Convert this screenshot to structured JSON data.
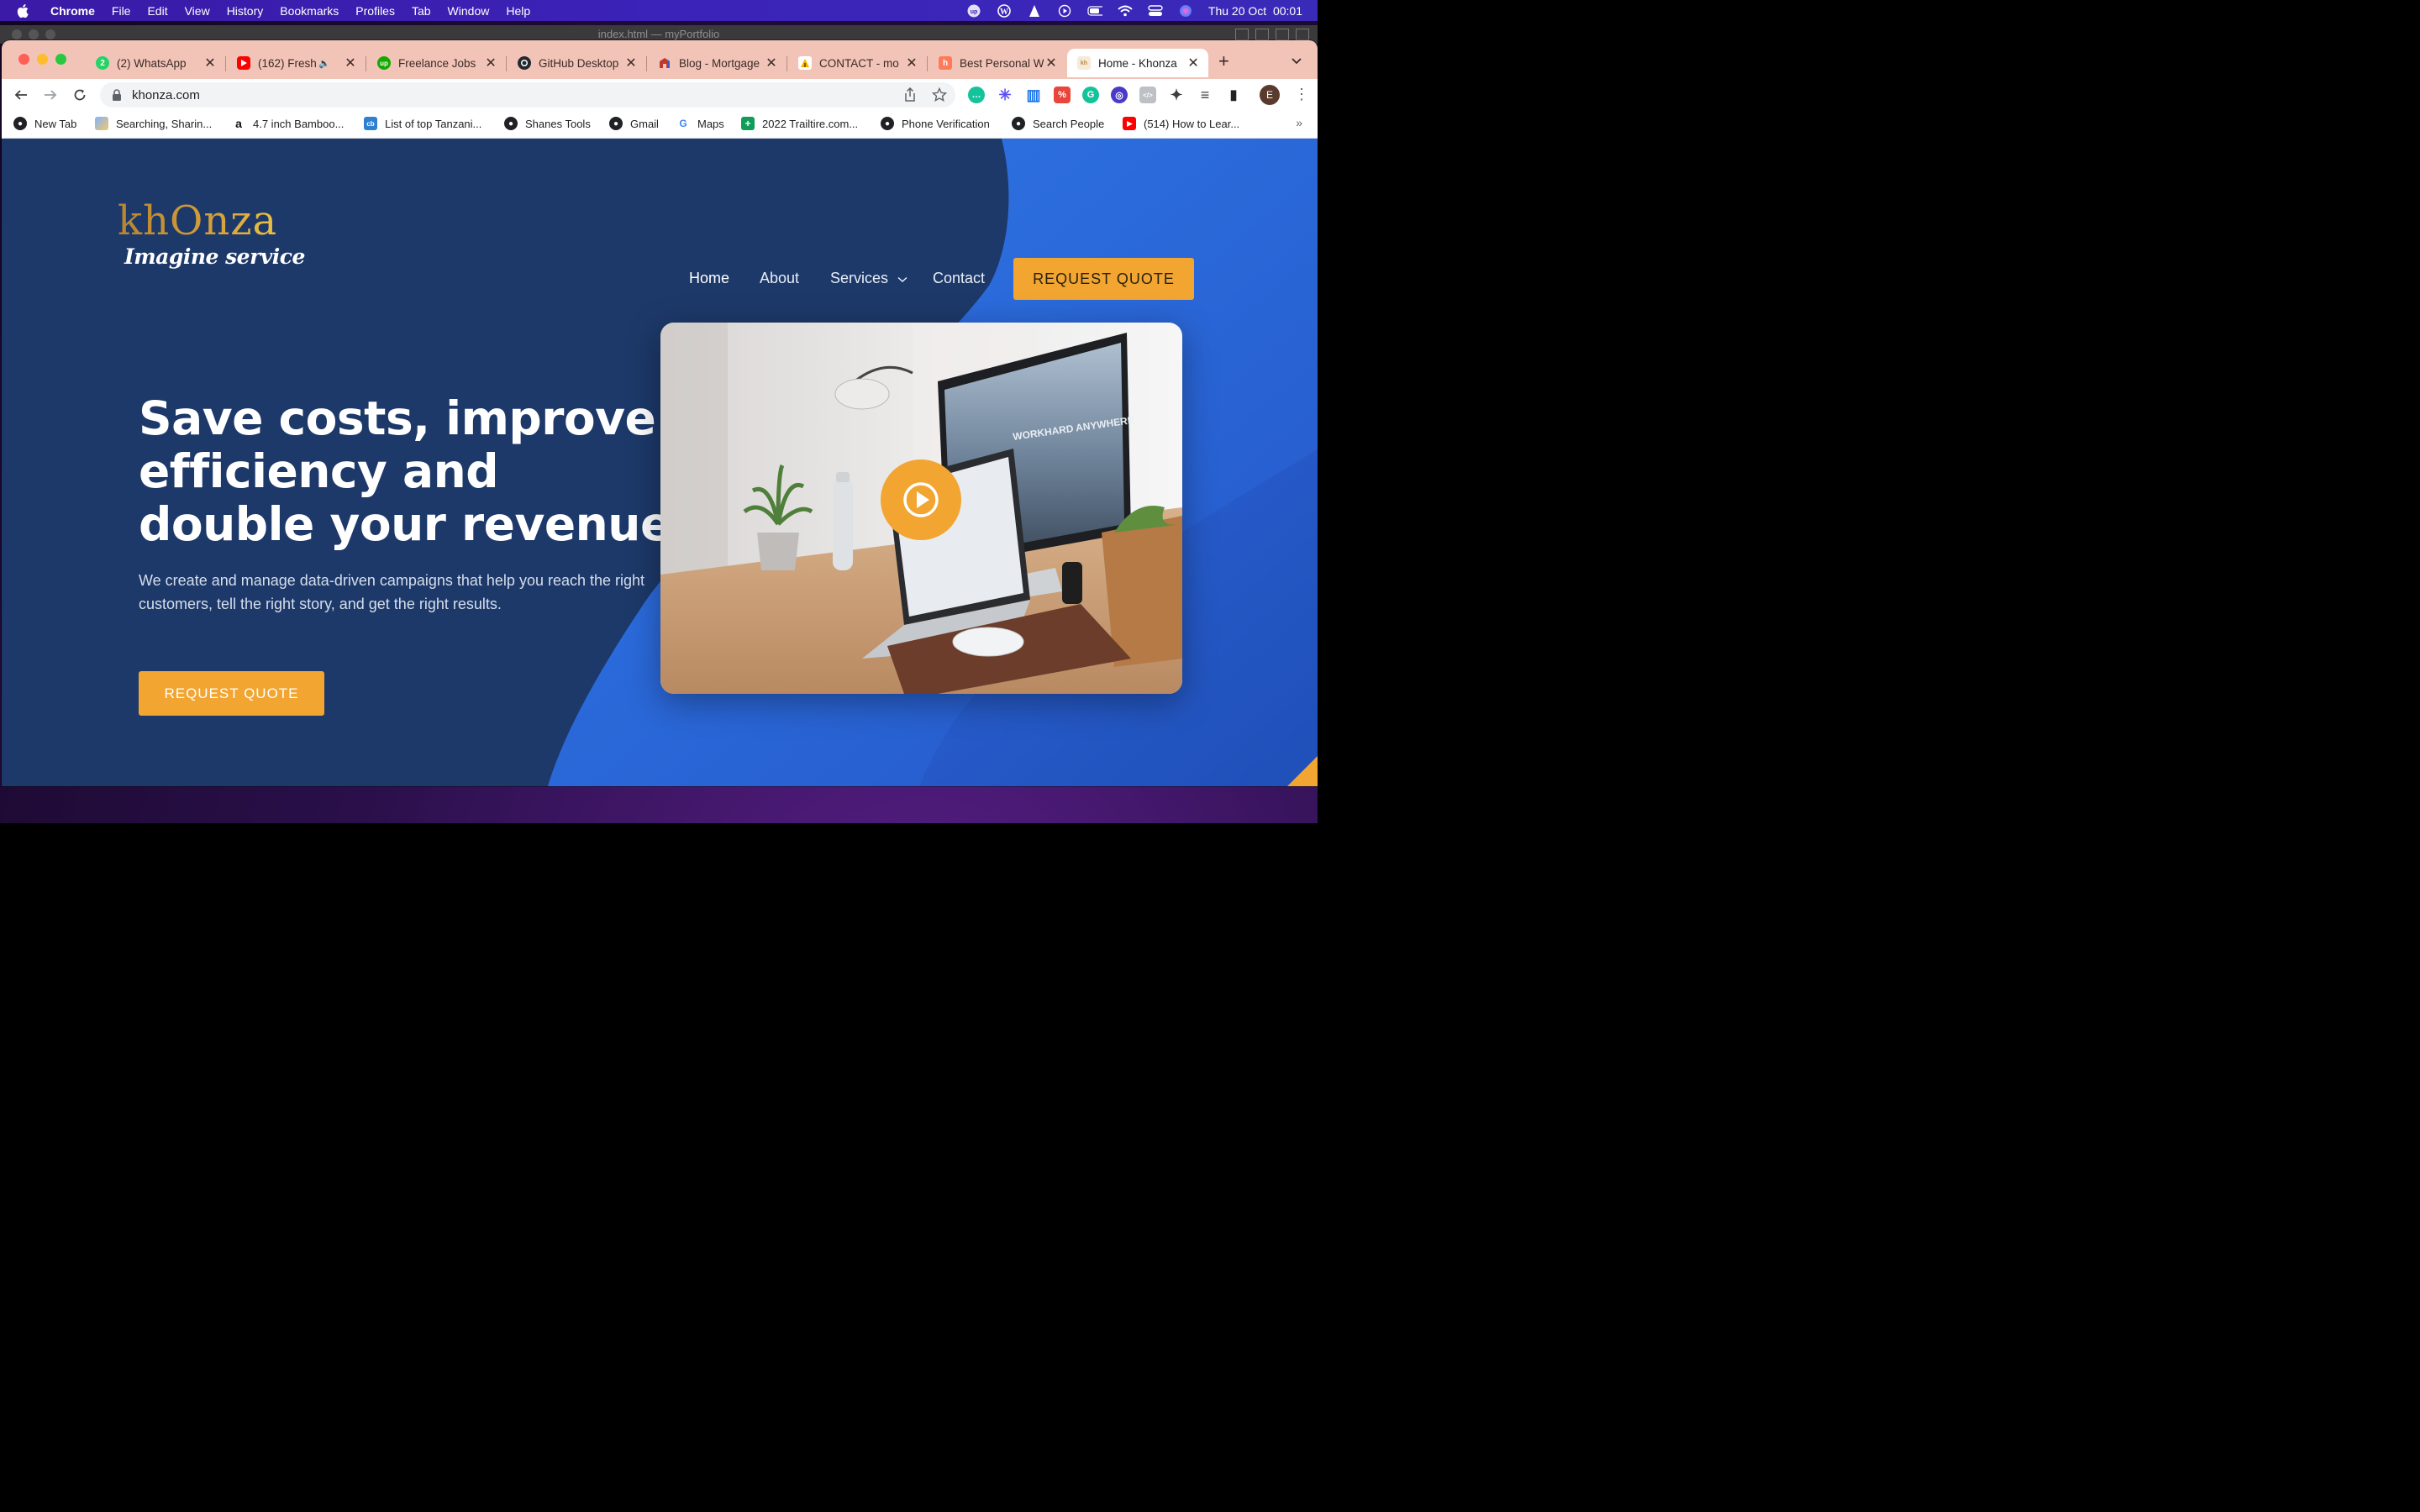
{
  "menubar": {
    "app": "Chrome",
    "items": [
      "File",
      "Edit",
      "View",
      "History",
      "Bookmarks",
      "Profiles",
      "Tab",
      "Window",
      "Help"
    ],
    "datetime": "Thu 20 Oct  00:01",
    "status_icons": [
      "upwork-icon",
      "wordpress-icon",
      "vlc-icon",
      "play-icon",
      "battery-icon",
      "wifi-icon",
      "control-center-icon",
      "siri-icon"
    ]
  },
  "background_window": {
    "title": "index.html — myPortfolio"
  },
  "tabs": [
    {
      "title": "(2) WhatsApp",
      "icon": "whatsapp-icon",
      "color": "#25d366",
      "badge": "2"
    },
    {
      "title": "(162) Fresh",
      "icon": "youtube-icon",
      "color": "#ff0000",
      "muted_indicator": "🔈"
    },
    {
      "title": "Freelance Jobs",
      "icon": "upwork-icon",
      "color": "#14a800",
      "badge": "up"
    },
    {
      "title": "GitHub Desktop",
      "icon": "github-icon",
      "color": "#24292f"
    },
    {
      "title": "Blog - Mortgage",
      "icon": "mortgage-icon",
      "color": "#c0392b"
    },
    {
      "title": "CONTACT - mo",
      "icon": "contact-icon",
      "color": "#f4b400"
    },
    {
      "title": "Best Personal W",
      "icon": "hubspot-icon",
      "color": "#ff7a59"
    },
    {
      "title": "Home - Khonza",
      "icon": "khonza-icon",
      "color": "#e0c8a0",
      "active": true
    }
  ],
  "toolbar": {
    "url": "khonza.com",
    "extensions": [
      {
        "icon": "grammarly-chat-icon",
        "color": "#15c39a",
        "glyph": "…"
      },
      {
        "icon": "snowflake-icon",
        "color": "#5b4ff5",
        "glyph": "✳"
      },
      {
        "icon": "bar-chart-icon",
        "color": "#1a73e8",
        "glyph": "▥"
      },
      {
        "icon": "lastpass-icon",
        "color": "#e8453c",
        "glyph": "%"
      },
      {
        "icon": "grammarly-icon",
        "color": "#15c39a",
        "glyph": "G"
      },
      {
        "icon": "loom-icon",
        "color": "#4b39c9",
        "glyph": "◎"
      },
      {
        "icon": "code-icon",
        "color": "#9aa0a6",
        "glyph": "</>"
      },
      {
        "icon": "puzzle-icon",
        "color": "#5f6368",
        "glyph": "✦"
      },
      {
        "icon": "media-icon",
        "color": "#5f6368",
        "glyph": "≡"
      },
      {
        "icon": "side-panel-icon",
        "color": "#202124",
        "glyph": "▮"
      }
    ],
    "profile_initial": "E"
  },
  "bookmarks": [
    {
      "label": "New Tab",
      "icon": "globe-icon"
    },
    {
      "label": "Searching, Sharin...",
      "icon": "image-icon"
    },
    {
      "label": "4.7 inch Bamboo...",
      "icon": "amazon-icon"
    },
    {
      "label": "List of top Tanzani...",
      "icon": "cb-icon"
    },
    {
      "label": "Shanes Tools",
      "icon": "globe-icon"
    },
    {
      "label": "Gmail",
      "icon": "globe-icon"
    },
    {
      "label": "Maps",
      "icon": "google-icon"
    },
    {
      "label": "2022 Trailtire.com...",
      "icon": "sheets-icon"
    },
    {
      "label": "Phone Verification",
      "icon": "globe-icon"
    },
    {
      "label": "Search People",
      "icon": "globe-icon"
    },
    {
      "label": "(514) How to Lear...",
      "icon": "youtube-icon"
    }
  ],
  "page": {
    "logo_word": "khOnza",
    "logo_tagline": "Imagine service",
    "nav": [
      "Home",
      "About",
      "Services",
      "Contact"
    ],
    "cta_top": "REQUEST QUOTE",
    "headline": "Save costs, improve efficiency and double your revenue",
    "lead": "We create and manage data-driven campaigns that help you reach the right customers, tell the right story, and get the right results.",
    "cta_main": "REQUEST QUOTE",
    "hero_image_text": "WORKHARD ANYWHERE"
  },
  "colors": {
    "accent": "#f2a531",
    "page_bg": "#1d3969",
    "wave_blue": "#2f6ee0",
    "tabstrip": "#f2c4b7"
  }
}
